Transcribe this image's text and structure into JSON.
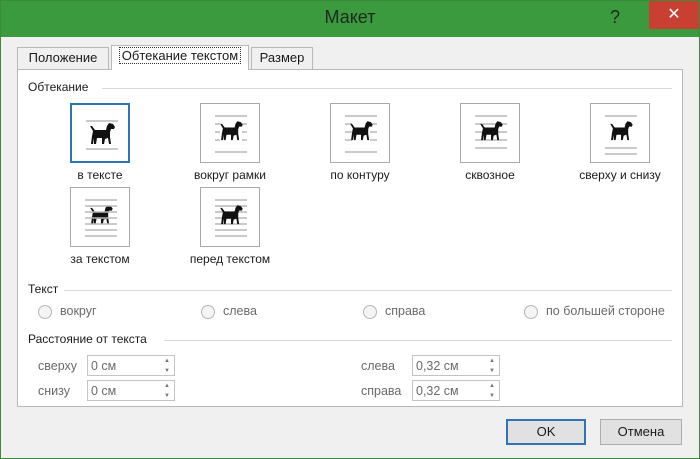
{
  "window": {
    "title": "Макет",
    "help_label": "?",
    "close_label": "✕"
  },
  "tabs": [
    {
      "label": "Положение"
    },
    {
      "label": "Обтекание текстом"
    },
    {
      "label": "Размер"
    }
  ],
  "wrapping": {
    "group_label": "Обтекание",
    "options": [
      {
        "label": "в тексте",
        "selected": true
      },
      {
        "label": "вокруг рамки",
        "selected": false
      },
      {
        "label": "по контуру",
        "selected": false
      },
      {
        "label": "сквозное",
        "selected": false
      },
      {
        "label": "сверху и снизу",
        "selected": false
      },
      {
        "label": "за текстом",
        "selected": false
      },
      {
        "label": "перед текстом",
        "selected": false
      }
    ]
  },
  "text_side": {
    "group_label": "Текст",
    "options": [
      {
        "label": "вокруг"
      },
      {
        "label": "слева"
      },
      {
        "label": "справа"
      },
      {
        "label": "по большей стороне"
      }
    ]
  },
  "distance": {
    "group_label": "Расстояние от текста",
    "top": {
      "label": "сверху",
      "value": "0 см"
    },
    "bottom": {
      "label": "снизу",
      "value": "0 см"
    },
    "left": {
      "label": "слева",
      "value": "0,32 см"
    },
    "right": {
      "label": "справа",
      "value": "0,32 см"
    }
  },
  "buttons": {
    "ok": "OK",
    "cancel": "Отмена"
  },
  "colors": {
    "titlebar": "#3a9a3d",
    "close": "#c94033",
    "accent": "#2e75b6"
  },
  "icons": [
    "help-icon",
    "close-icon",
    "dog-icon",
    "radio-icon",
    "spin-up-icon",
    "spin-down-icon"
  ]
}
